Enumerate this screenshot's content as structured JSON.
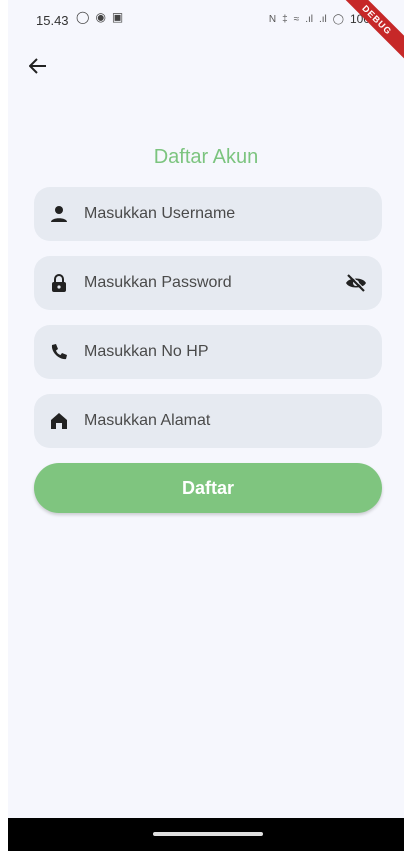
{
  "status_bar": {
    "time": "15.43",
    "battery": "100",
    "debug_label": "DEBUG"
  },
  "title": "Daftar Akun",
  "fields": {
    "username": {
      "placeholder": "Masukkan Username",
      "icon": "person-icon"
    },
    "password": {
      "placeholder": "Masukkan Password",
      "icon": "lock-icon",
      "trailing_icon": "visibility-off-icon"
    },
    "phone": {
      "placeholder": "Masukkan No HP",
      "icon": "phone-icon"
    },
    "address": {
      "placeholder": "Masukkan Alamat",
      "icon": "home-icon"
    }
  },
  "submit_label": "Daftar",
  "colors": {
    "accent": "#7fc57f",
    "title": "#7cc47f",
    "field_bg": "#e6eaf1",
    "page_bg": "#f6f7fd"
  }
}
